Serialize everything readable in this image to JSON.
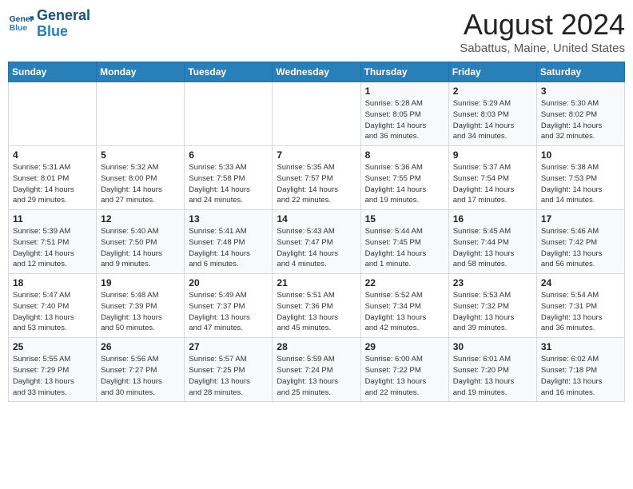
{
  "logo": {
    "line1": "General",
    "line2": "Blue"
  },
  "title": "August 2024",
  "location": "Sabattus, Maine, United States",
  "headers": [
    "Sunday",
    "Monday",
    "Tuesday",
    "Wednesday",
    "Thursday",
    "Friday",
    "Saturday"
  ],
  "weeks": [
    [
      {
        "day": "",
        "detail": ""
      },
      {
        "day": "",
        "detail": ""
      },
      {
        "day": "",
        "detail": ""
      },
      {
        "day": "",
        "detail": ""
      },
      {
        "day": "1",
        "detail": "Sunrise: 5:28 AM\nSunset: 8:05 PM\nDaylight: 14 hours\nand 36 minutes."
      },
      {
        "day": "2",
        "detail": "Sunrise: 5:29 AM\nSunset: 8:03 PM\nDaylight: 14 hours\nand 34 minutes."
      },
      {
        "day": "3",
        "detail": "Sunrise: 5:30 AM\nSunset: 8:02 PM\nDaylight: 14 hours\nand 32 minutes."
      }
    ],
    [
      {
        "day": "4",
        "detail": "Sunrise: 5:31 AM\nSunset: 8:01 PM\nDaylight: 14 hours\nand 29 minutes."
      },
      {
        "day": "5",
        "detail": "Sunrise: 5:32 AM\nSunset: 8:00 PM\nDaylight: 14 hours\nand 27 minutes."
      },
      {
        "day": "6",
        "detail": "Sunrise: 5:33 AM\nSunset: 7:58 PM\nDaylight: 14 hours\nand 24 minutes."
      },
      {
        "day": "7",
        "detail": "Sunrise: 5:35 AM\nSunset: 7:57 PM\nDaylight: 14 hours\nand 22 minutes."
      },
      {
        "day": "8",
        "detail": "Sunrise: 5:36 AM\nSunset: 7:55 PM\nDaylight: 14 hours\nand 19 minutes."
      },
      {
        "day": "9",
        "detail": "Sunrise: 5:37 AM\nSunset: 7:54 PM\nDaylight: 14 hours\nand 17 minutes."
      },
      {
        "day": "10",
        "detail": "Sunrise: 5:38 AM\nSunset: 7:53 PM\nDaylight: 14 hours\nand 14 minutes."
      }
    ],
    [
      {
        "day": "11",
        "detail": "Sunrise: 5:39 AM\nSunset: 7:51 PM\nDaylight: 14 hours\nand 12 minutes."
      },
      {
        "day": "12",
        "detail": "Sunrise: 5:40 AM\nSunset: 7:50 PM\nDaylight: 14 hours\nand 9 minutes."
      },
      {
        "day": "13",
        "detail": "Sunrise: 5:41 AM\nSunset: 7:48 PM\nDaylight: 14 hours\nand 6 minutes."
      },
      {
        "day": "14",
        "detail": "Sunrise: 5:43 AM\nSunset: 7:47 PM\nDaylight: 14 hours\nand 4 minutes."
      },
      {
        "day": "15",
        "detail": "Sunrise: 5:44 AM\nSunset: 7:45 PM\nDaylight: 14 hours\nand 1 minute."
      },
      {
        "day": "16",
        "detail": "Sunrise: 5:45 AM\nSunset: 7:44 PM\nDaylight: 13 hours\nand 58 minutes."
      },
      {
        "day": "17",
        "detail": "Sunrise: 5:46 AM\nSunset: 7:42 PM\nDaylight: 13 hours\nand 56 minutes."
      }
    ],
    [
      {
        "day": "18",
        "detail": "Sunrise: 5:47 AM\nSunset: 7:40 PM\nDaylight: 13 hours\nand 53 minutes."
      },
      {
        "day": "19",
        "detail": "Sunrise: 5:48 AM\nSunset: 7:39 PM\nDaylight: 13 hours\nand 50 minutes."
      },
      {
        "day": "20",
        "detail": "Sunrise: 5:49 AM\nSunset: 7:37 PM\nDaylight: 13 hours\nand 47 minutes."
      },
      {
        "day": "21",
        "detail": "Sunrise: 5:51 AM\nSunset: 7:36 PM\nDaylight: 13 hours\nand 45 minutes."
      },
      {
        "day": "22",
        "detail": "Sunrise: 5:52 AM\nSunset: 7:34 PM\nDaylight: 13 hours\nand 42 minutes."
      },
      {
        "day": "23",
        "detail": "Sunrise: 5:53 AM\nSunset: 7:32 PM\nDaylight: 13 hours\nand 39 minutes."
      },
      {
        "day": "24",
        "detail": "Sunrise: 5:54 AM\nSunset: 7:31 PM\nDaylight: 13 hours\nand 36 minutes."
      }
    ],
    [
      {
        "day": "25",
        "detail": "Sunrise: 5:55 AM\nSunset: 7:29 PM\nDaylight: 13 hours\nand 33 minutes."
      },
      {
        "day": "26",
        "detail": "Sunrise: 5:56 AM\nSunset: 7:27 PM\nDaylight: 13 hours\nand 30 minutes."
      },
      {
        "day": "27",
        "detail": "Sunrise: 5:57 AM\nSunset: 7:25 PM\nDaylight: 13 hours\nand 28 minutes."
      },
      {
        "day": "28",
        "detail": "Sunrise: 5:59 AM\nSunset: 7:24 PM\nDaylight: 13 hours\nand 25 minutes."
      },
      {
        "day": "29",
        "detail": "Sunrise: 6:00 AM\nSunset: 7:22 PM\nDaylight: 13 hours\nand 22 minutes."
      },
      {
        "day": "30",
        "detail": "Sunrise: 6:01 AM\nSunset: 7:20 PM\nDaylight: 13 hours\nand 19 minutes."
      },
      {
        "day": "31",
        "detail": "Sunrise: 6:02 AM\nSunset: 7:18 PM\nDaylight: 13 hours\nand 16 minutes."
      }
    ]
  ]
}
